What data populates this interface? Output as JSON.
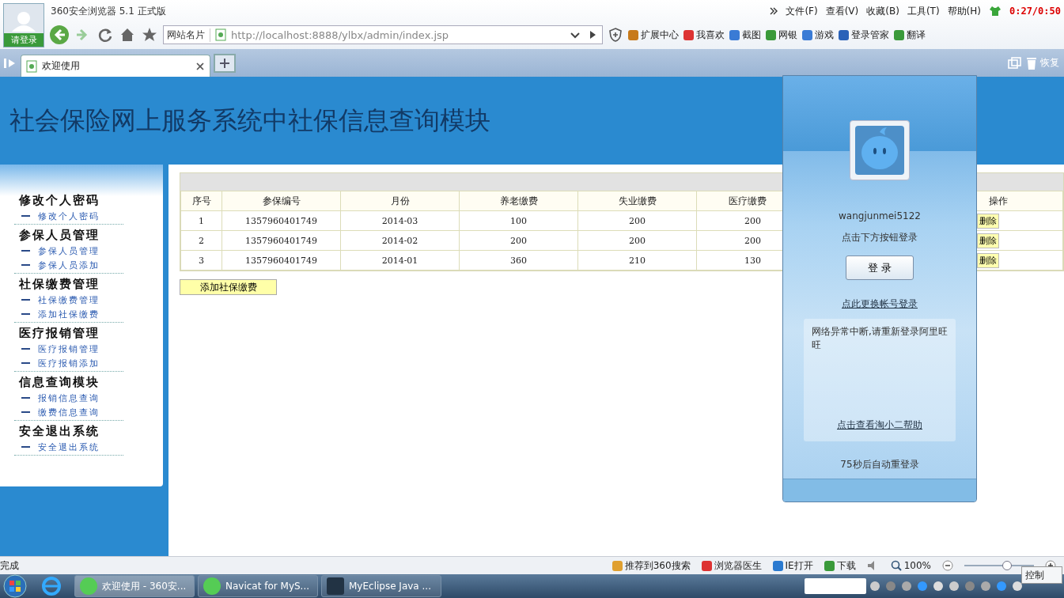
{
  "browser": {
    "title": "360安全浏览器 5.1 正式版",
    "login_label": "请登录",
    "menu": [
      "文件(F)",
      "查看(V)",
      "收藏(B)",
      "工具(T)",
      "帮助(H)"
    ],
    "timer": "0:27/0:50",
    "site_names": "网站名片",
    "address": "http://localhost:8888/ylbx/admin/index.jsp",
    "toolbar": [
      "扩展中心",
      "我喜欢",
      "截图",
      "网银",
      "游戏",
      "登录管家",
      "翻译"
    ],
    "tabs": [
      {
        "label": "欢迎使用",
        "selected": true
      }
    ],
    "restore": "恢复"
  },
  "page": {
    "title": "社会保险网上服务系统中社保信息查询模块",
    "sidebar": [
      {
        "heading": "修改个人密码",
        "links": [
          "修改个人密码"
        ]
      },
      {
        "heading": "参保人员管理",
        "links": [
          "参保人员管理",
          "参保人员添加"
        ]
      },
      {
        "heading": "社保缴费管理",
        "links": [
          "社保缴费管理",
          "添加社保缴费"
        ]
      },
      {
        "heading": "医疗报销管理",
        "links": [
          "医疗报销管理",
          "医疗报销添加"
        ]
      },
      {
        "heading": "信息查询模块",
        "links": [
          "报销信息查询",
          "缴费信息查询"
        ]
      },
      {
        "heading": "安全退出系统",
        "links": [
          "安全退出系统"
        ]
      }
    ],
    "table": {
      "columns": [
        "序号",
        "参保编号",
        "月份",
        "养老缴费",
        "失业缴费",
        "医疗缴费",
        "操作"
      ],
      "rows": [
        [
          "1",
          "1357960401749",
          "2014-03",
          "100",
          "200",
          "200",
          "删除"
        ],
        [
          "2",
          "1357960401749",
          "2014-02",
          "200",
          "200",
          "200",
          "删除"
        ],
        [
          "3",
          "1357960401749",
          "2014-01",
          "360",
          "210",
          "130",
          "删除"
        ]
      ]
    },
    "add_button": "添加社保缴费"
  },
  "popup": {
    "username": "wangjunmei5122",
    "hint": "点击下方按钮登录",
    "login_button": "登 录",
    "switch_link": "点此更换帐号登录",
    "message": "网络异常中断,请重新登录阿里旺旺",
    "help_link": "点击查看淘小二帮助",
    "countdown": "75秒后自动重登录"
  },
  "status_bar": {
    "text": "完成",
    "items": [
      "推荐到360搜索",
      "浏览器医生",
      "IE打开",
      "下载"
    ],
    "zoom": "100%",
    "zoom_slider": {
      "level": 0.6
    }
  },
  "taskbar": {
    "windows": [
      {
        "label": "欢迎使用 - 360安...",
        "selected": true
      },
      {
        "label": "Navicat for MyS...",
        "selected": false
      },
      {
        "label": "MyEclipse Java ...",
        "selected": false
      }
    ],
    "tooltip": "控制"
  }
}
